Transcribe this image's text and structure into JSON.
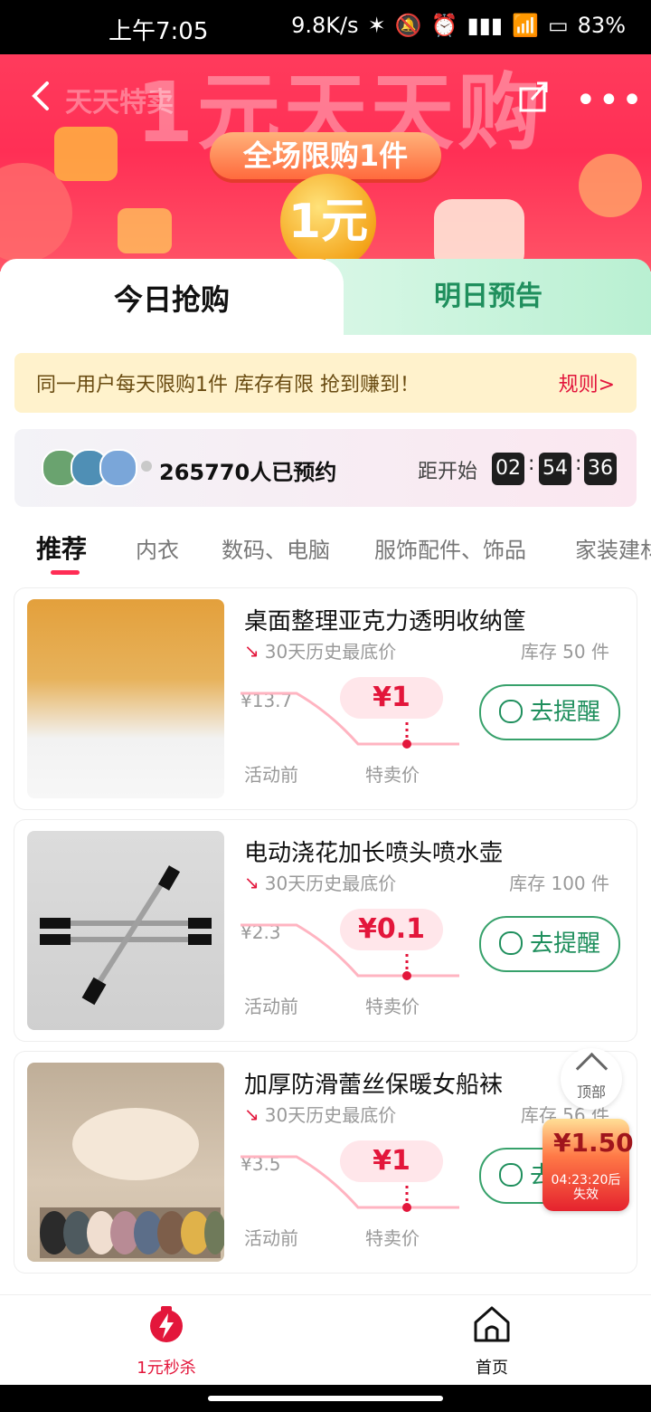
{
  "status_bar": {
    "time": "上午7:05",
    "net_speed": "9.8K/s",
    "battery": "83%"
  },
  "hero": {
    "faded_title": "1元天天购",
    "faded_sub": "天天特卖",
    "pill": "全场限购1件",
    "coin": "1元"
  },
  "top_tabs": {
    "today": "今日抢购",
    "tomorrow": "明日预告"
  },
  "notice": {
    "text": "同一用户每天限购1件 库存有限 抢到赚到！",
    "rule": "规则>"
  },
  "reserve": {
    "count_text": "265770人已预约",
    "start_label": "距开始",
    "hh": "02",
    "mm": "54",
    "ss": "36"
  },
  "categories": [
    "推荐",
    "内衣",
    "数码、电脑",
    "服饰配件、饰品",
    "家装建材"
  ],
  "products": [
    {
      "title": "桌面整理亚克力透明收纳筐",
      "hist": "30天历史最底价",
      "stock": "库存 50 件",
      "old_price": "¥13.7",
      "new_price": "¥1",
      "before_label": "活动前",
      "sale_label": "特卖价",
      "remind": "去提醒"
    },
    {
      "title": "电动浇花加长喷头喷水壶",
      "hist": "30天历史最底价",
      "stock": "库存 100 件",
      "old_price": "¥2.3",
      "new_price": "¥0.1",
      "before_label": "活动前",
      "sale_label": "特卖价",
      "remind": "去提醒"
    },
    {
      "title": "加厚防滑蕾丝保暖女船袜",
      "hist": "30天历史最底价",
      "stock": "库存 56 件",
      "old_price": "¥3.5",
      "new_price": "¥1",
      "before_label": "活动前",
      "sale_label": "特卖价",
      "remind": "去提醒"
    }
  ],
  "float": {
    "top_label": "顶部",
    "amount": "¥1.50",
    "expire": "04:23:20后失效"
  },
  "bottom_nav": {
    "seckill": "1元秒杀",
    "home": "首页"
  },
  "colors": {
    "accent": "#e3163b",
    "green": "#1f8f5d"
  },
  "icons": {
    "back": "chevron-left-icon",
    "share": "share-icon",
    "more": "more-icon",
    "seckill": "lightning-icon",
    "home": "home-icon"
  }
}
